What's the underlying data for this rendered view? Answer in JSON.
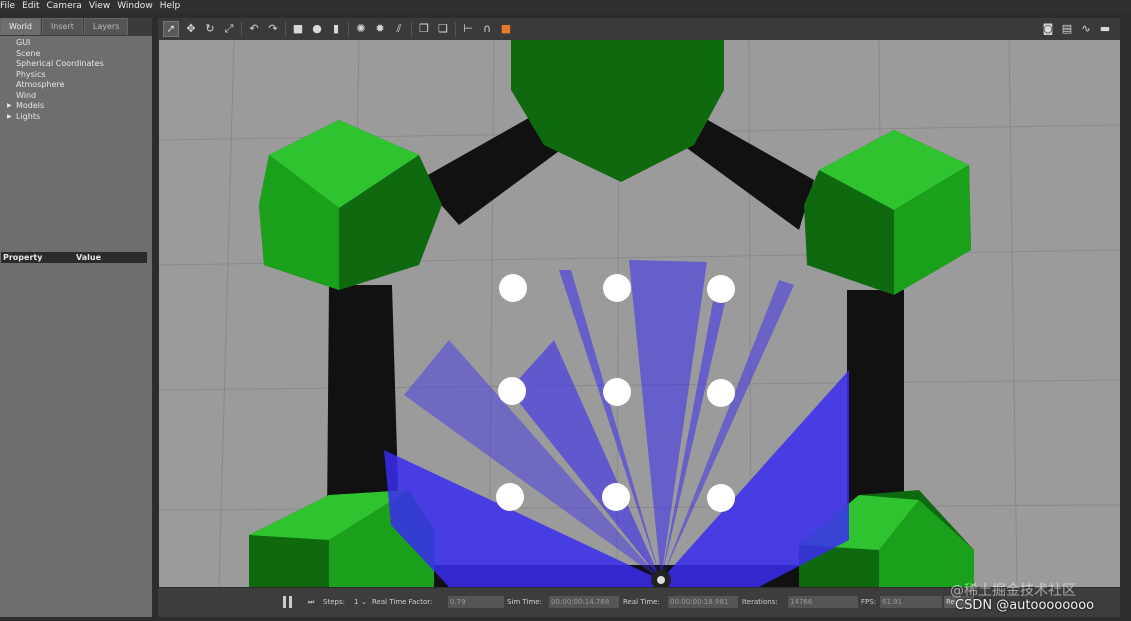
{
  "menu": [
    "File",
    "Edit",
    "Camera",
    "View",
    "Window",
    "Help"
  ],
  "left_panel": {
    "tabs": [
      "World",
      "Insert",
      "Layers"
    ],
    "tree": [
      {
        "label": "GUI",
        "expandable": false
      },
      {
        "label": "Scene",
        "expandable": false
      },
      {
        "label": "Spherical Coordinates",
        "expandable": false
      },
      {
        "label": "Physics",
        "expandable": false
      },
      {
        "label": "Atmosphere",
        "expandable": false
      },
      {
        "label": "Wind",
        "expandable": false
      },
      {
        "label": "Models",
        "expandable": true
      },
      {
        "label": "Lights",
        "expandable": true
      }
    ],
    "property_header": {
      "property": "Property",
      "value": "Value"
    }
  },
  "toolbar": {
    "tools": [
      "select-icon",
      "translate-icon",
      "rotate-icon",
      "scale-icon",
      "undo-icon",
      "redo-icon",
      "box-icon",
      "sphere-icon",
      "cylinder-icon",
      "point-light-icon",
      "spot-light-icon",
      "directional-light-icon",
      "copy-icon",
      "paste-icon",
      "align-icon",
      "snap-icon",
      "change-view-icon"
    ],
    "right_tools": [
      "screenshot-icon",
      "log-icon",
      "plot-icon",
      "video-icon"
    ]
  },
  "bottom": {
    "steps_label": "Steps:",
    "steps_value": "1",
    "rtf_label": "Real Time Factor:",
    "rtf_value": "0.79",
    "sim_time_label": "Sim Time:",
    "sim_time_value": "00:00:00:14.768",
    "real_time_label": "Real Time:",
    "real_time_value": "00:00:00:18.981",
    "iterations_label": "Iterations:",
    "iterations_value": "14766",
    "fps_label": "FPS:",
    "fps_value": "61.91",
    "reset_label": "Re"
  },
  "watermark": {
    "line1": "@稀土掘金技术社区",
    "line2": "CSDN @autoooooooo"
  },
  "colors": {
    "obstacle_green": "#18b818",
    "dark_green": "#0f6a0f",
    "laser_blue": "#3a2cf0",
    "wall_black": "#111111",
    "ground_gray": "#9b9b9b"
  }
}
